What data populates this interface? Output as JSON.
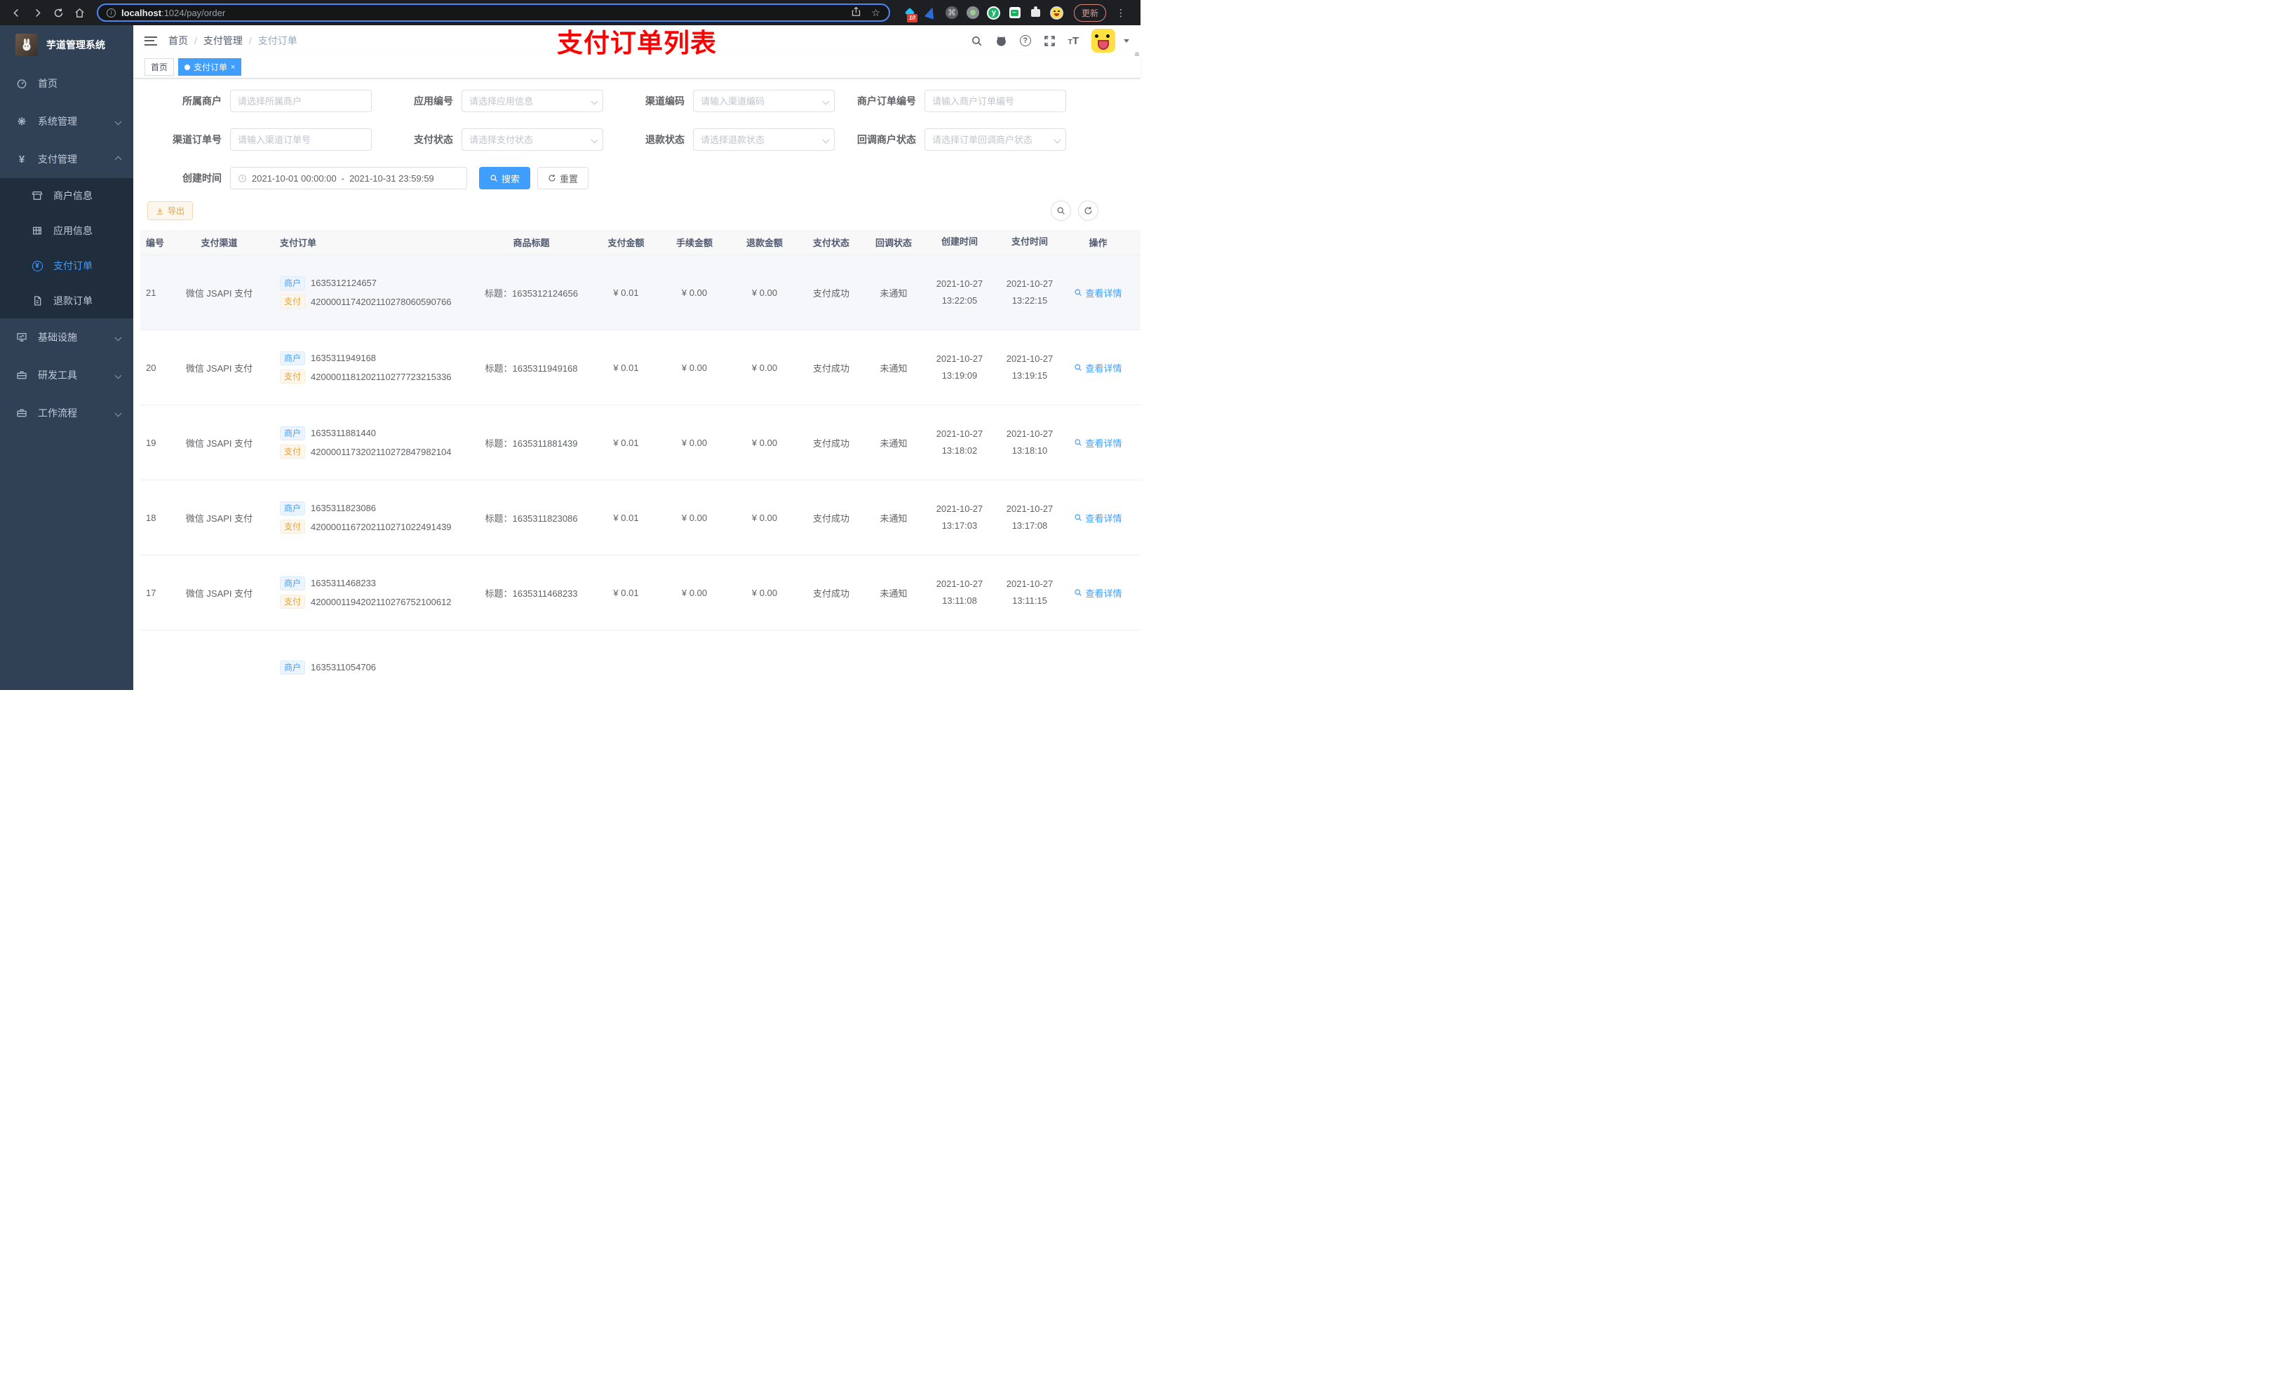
{
  "browser": {
    "url_host": "localhost",
    "url_rest": ":1024/pay/order",
    "extension_badge": "10",
    "update_label": "更新"
  },
  "sidebar": {
    "title": "芋道管理系统",
    "items": [
      {
        "icon": "dashboard-icon",
        "label": "首页"
      },
      {
        "icon": "gear-icon",
        "label": "系统管理",
        "chevron": "down"
      },
      {
        "icon": "yen-icon",
        "label": "支付管理",
        "chevron": "up",
        "children": [
          {
            "icon": "shop-icon",
            "label": "商户信息"
          },
          {
            "icon": "grid-icon",
            "label": "应用信息"
          },
          {
            "icon": "pay-circle-icon",
            "label": "支付订单",
            "active": true
          },
          {
            "icon": "document-icon",
            "label": "退款订单"
          }
        ]
      },
      {
        "icon": "monitor-icon",
        "label": "基础设施",
        "chevron": "down"
      },
      {
        "icon": "toolbox-icon",
        "label": "研发工具",
        "chevron": "down"
      },
      {
        "icon": "briefcase-icon",
        "label": "工作流程",
        "chevron": "down"
      }
    ]
  },
  "navbar": {
    "breadcrumb": [
      "首页",
      "支付管理",
      "支付订单"
    ],
    "overlay_title": "支付订单列表"
  },
  "tabs": [
    {
      "label": "首页",
      "active": false
    },
    {
      "label": "支付订单",
      "active": true,
      "closable": true
    }
  ],
  "filters": {
    "rows": [
      [
        {
          "label": "所属商户",
          "placeholder": "请选择所属商户",
          "type": "input"
        },
        {
          "label": "应用编号",
          "placeholder": "请选择应用信息",
          "type": "select"
        },
        {
          "label": "渠道编码",
          "placeholder": "请输入渠道编码",
          "type": "select"
        },
        {
          "label": "商户订单编号",
          "placeholder": "请输入商户订单编号",
          "type": "input"
        }
      ],
      [
        {
          "label": "渠道订单号",
          "placeholder": "请输入渠道订单号",
          "type": "input"
        },
        {
          "label": "支付状态",
          "placeholder": "请选择支付状态",
          "type": "select"
        },
        {
          "label": "退款状态",
          "placeholder": "请选择退款状态",
          "type": "select"
        },
        {
          "label": "回调商户状态",
          "placeholder": "请选择订单回调商户状态",
          "type": "select"
        }
      ]
    ],
    "date": {
      "label": "创建时间",
      "start": "2021-10-01 00:00:00",
      "separator": "-",
      "end": "2021-10-31 23:59:59"
    },
    "search_label": "搜索",
    "reset_label": "重置",
    "export_label": "导出"
  },
  "table": {
    "columns": [
      "编号",
      "支付渠道",
      "支付订单",
      "商品标题",
      "支付金额",
      "手续金额",
      "退款金额",
      "支付状态",
      "回调状态",
      "创建时间",
      "支付时间",
      "操作"
    ],
    "merchant_tag": "商户",
    "pay_tag": "支付",
    "title_prefix": "标题：",
    "action_label": "查看详情",
    "rows": [
      {
        "id": "21",
        "channel": "微信 JSAPI 支付",
        "merchant_no": "1635312124657",
        "pay_no": "4200001174202110278060590766",
        "title": "1635312124656",
        "amount": "¥ 0.01",
        "fee": "¥ 0.00",
        "refund": "¥ 0.00",
        "status": "支付成功",
        "notify": "未通知",
        "create_date": "2021-10-27",
        "create_time": "13:22:05",
        "pay_date": "2021-10-27",
        "pay_time": "13:22:15"
      },
      {
        "id": "20",
        "channel": "微信 JSAPI 支付",
        "merchant_no": "1635311949168",
        "pay_no": "4200001181202110277723215336",
        "title": "1635311949168",
        "amount": "¥ 0.01",
        "fee": "¥ 0.00",
        "refund": "¥ 0.00",
        "status": "支付成功",
        "notify": "未通知",
        "create_date": "2021-10-27",
        "create_time": "13:19:09",
        "pay_date": "2021-10-27",
        "pay_time": "13:19:15"
      },
      {
        "id": "19",
        "channel": "微信 JSAPI 支付",
        "merchant_no": "1635311881440",
        "pay_no": "4200001173202110272847982104",
        "title": "1635311881439",
        "amount": "¥ 0.01",
        "fee": "¥ 0.00",
        "refund": "¥ 0.00",
        "status": "支付成功",
        "notify": "未通知",
        "create_date": "2021-10-27",
        "create_time": "13:18:02",
        "pay_date": "2021-10-27",
        "pay_time": "13:18:10"
      },
      {
        "id": "18",
        "channel": "微信 JSAPI 支付",
        "merchant_no": "1635311823086",
        "pay_no": "4200001167202110271022491439",
        "title": "1635311823086",
        "amount": "¥ 0.01",
        "fee": "¥ 0.00",
        "refund": "¥ 0.00",
        "status": "支付成功",
        "notify": "未通知",
        "create_date": "2021-10-27",
        "create_time": "13:17:03",
        "pay_date": "2021-10-27",
        "pay_time": "13:17:08"
      },
      {
        "id": "17",
        "channel": "微信 JSAPI 支付",
        "merchant_no": "1635311468233",
        "pay_no": "4200001194202110276752100612",
        "title": "1635311468233",
        "amount": "¥ 0.01",
        "fee": "¥ 0.00",
        "refund": "¥ 0.00",
        "status": "支付成功",
        "notify": "未通知",
        "create_date": "2021-10-27",
        "create_time": "13:11:08",
        "pay_date": "2021-10-27",
        "pay_time": "13:11:15"
      }
    ],
    "partial_row": {
      "merchant_no": "1635311054706"
    }
  }
}
